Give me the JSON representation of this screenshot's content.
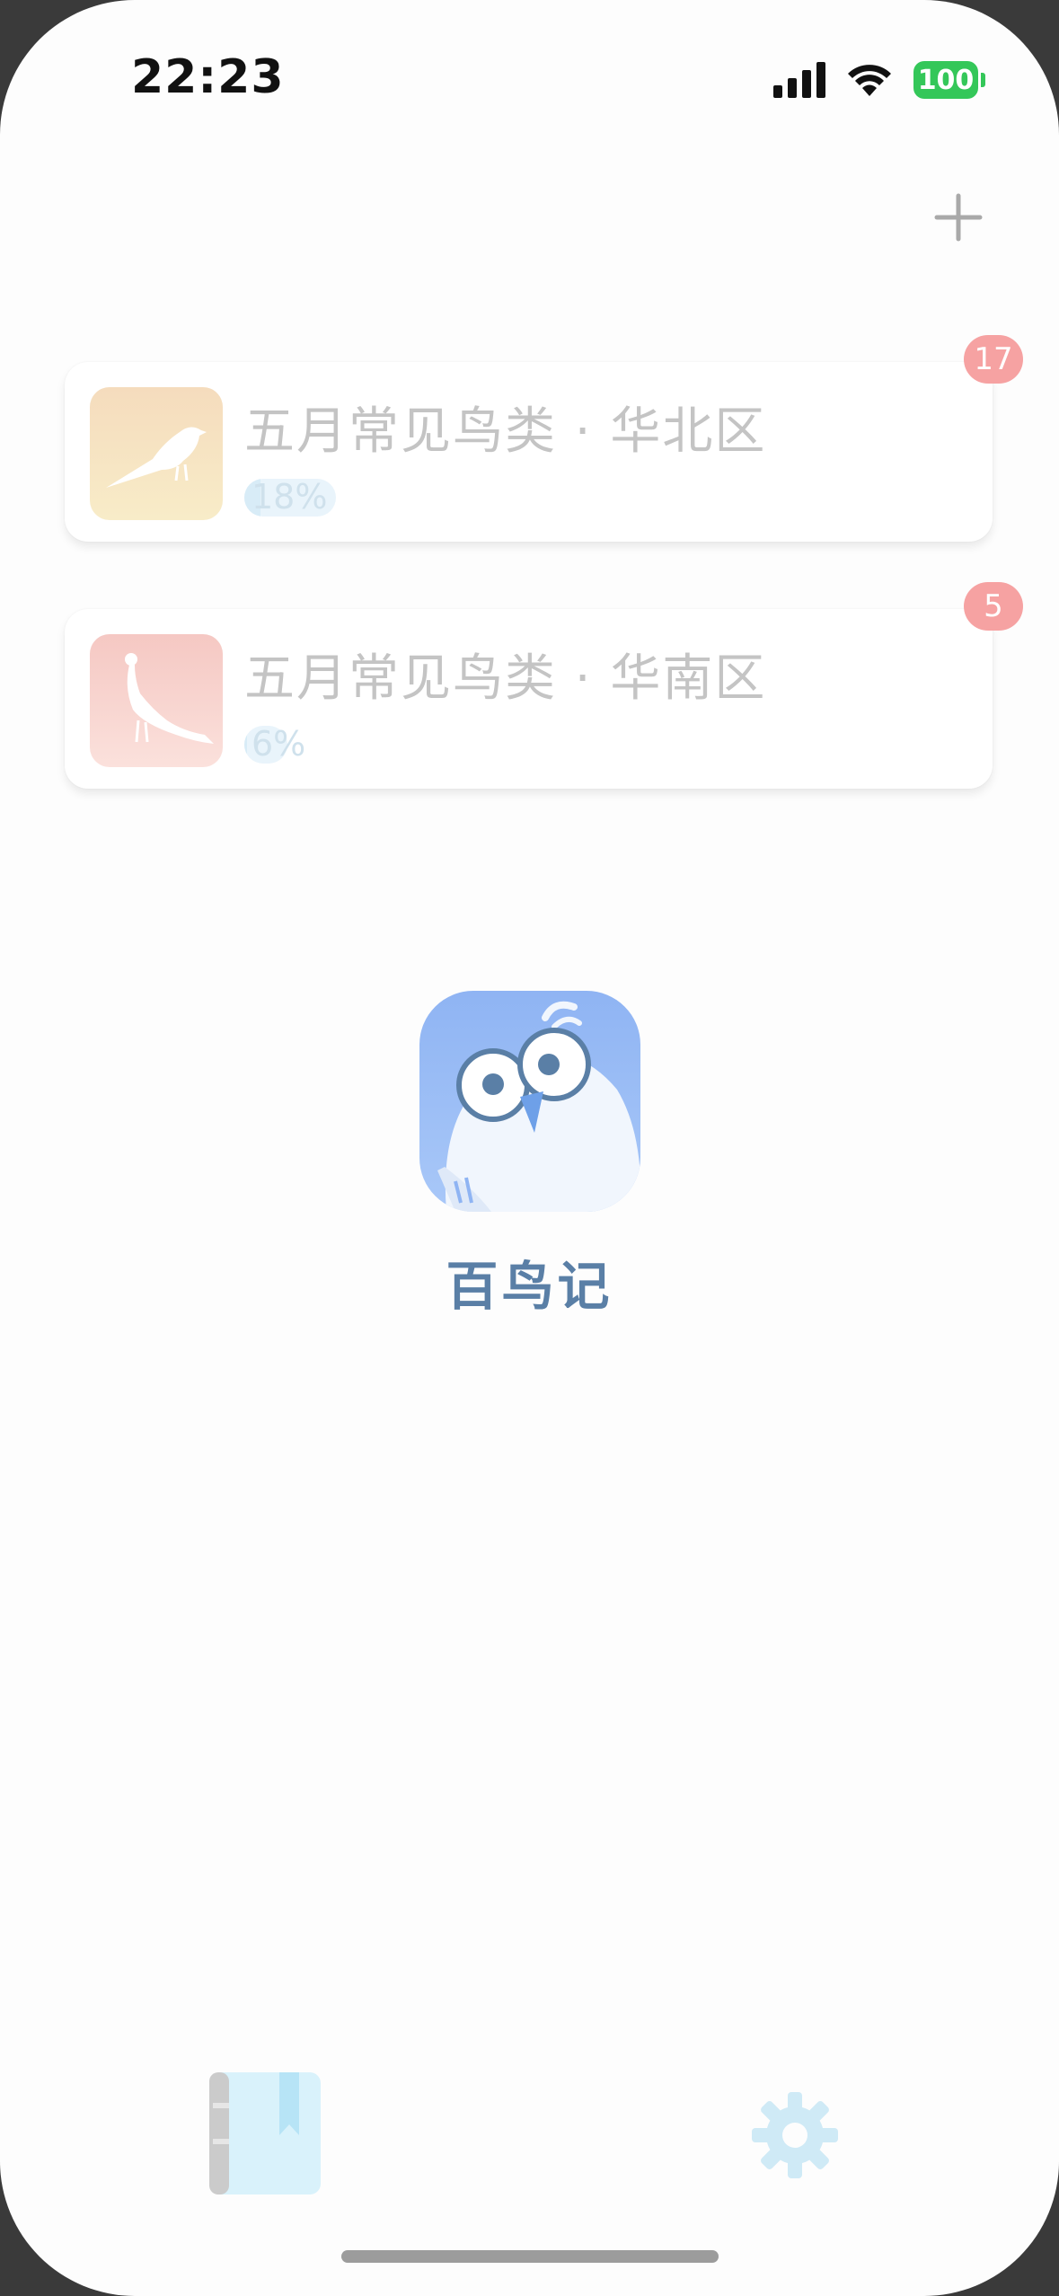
{
  "status_bar": {
    "time": "22:23",
    "battery": "100",
    "signal_icon": "signal-icon",
    "wifi_icon": "wifi-icon"
  },
  "header": {
    "add_icon": "plus-icon"
  },
  "lists": [
    {
      "title": "五月常见鸟类 · 华北区",
      "progress_text": "18%",
      "progress": 0.18,
      "badge": "17",
      "thumb_icon": "magpie-icon",
      "thumb_color": "#f6e3c3"
    },
    {
      "title": "五月常见鸟类 · 华南区",
      "progress_text": "6%",
      "progress": 0.06,
      "badge": "5",
      "thumb_icon": "peacock-icon",
      "thumb_color": "#f6cfca"
    }
  ],
  "app": {
    "name": "百鸟记",
    "logo_icon": "owl-logo-icon"
  },
  "tab_bar": {
    "book_icon": "book-icon",
    "settings_icon": "gear-icon"
  },
  "colors": {
    "badge": "#f6a2a2",
    "app_name": "#5a7fa6",
    "battery": "#34c759"
  }
}
